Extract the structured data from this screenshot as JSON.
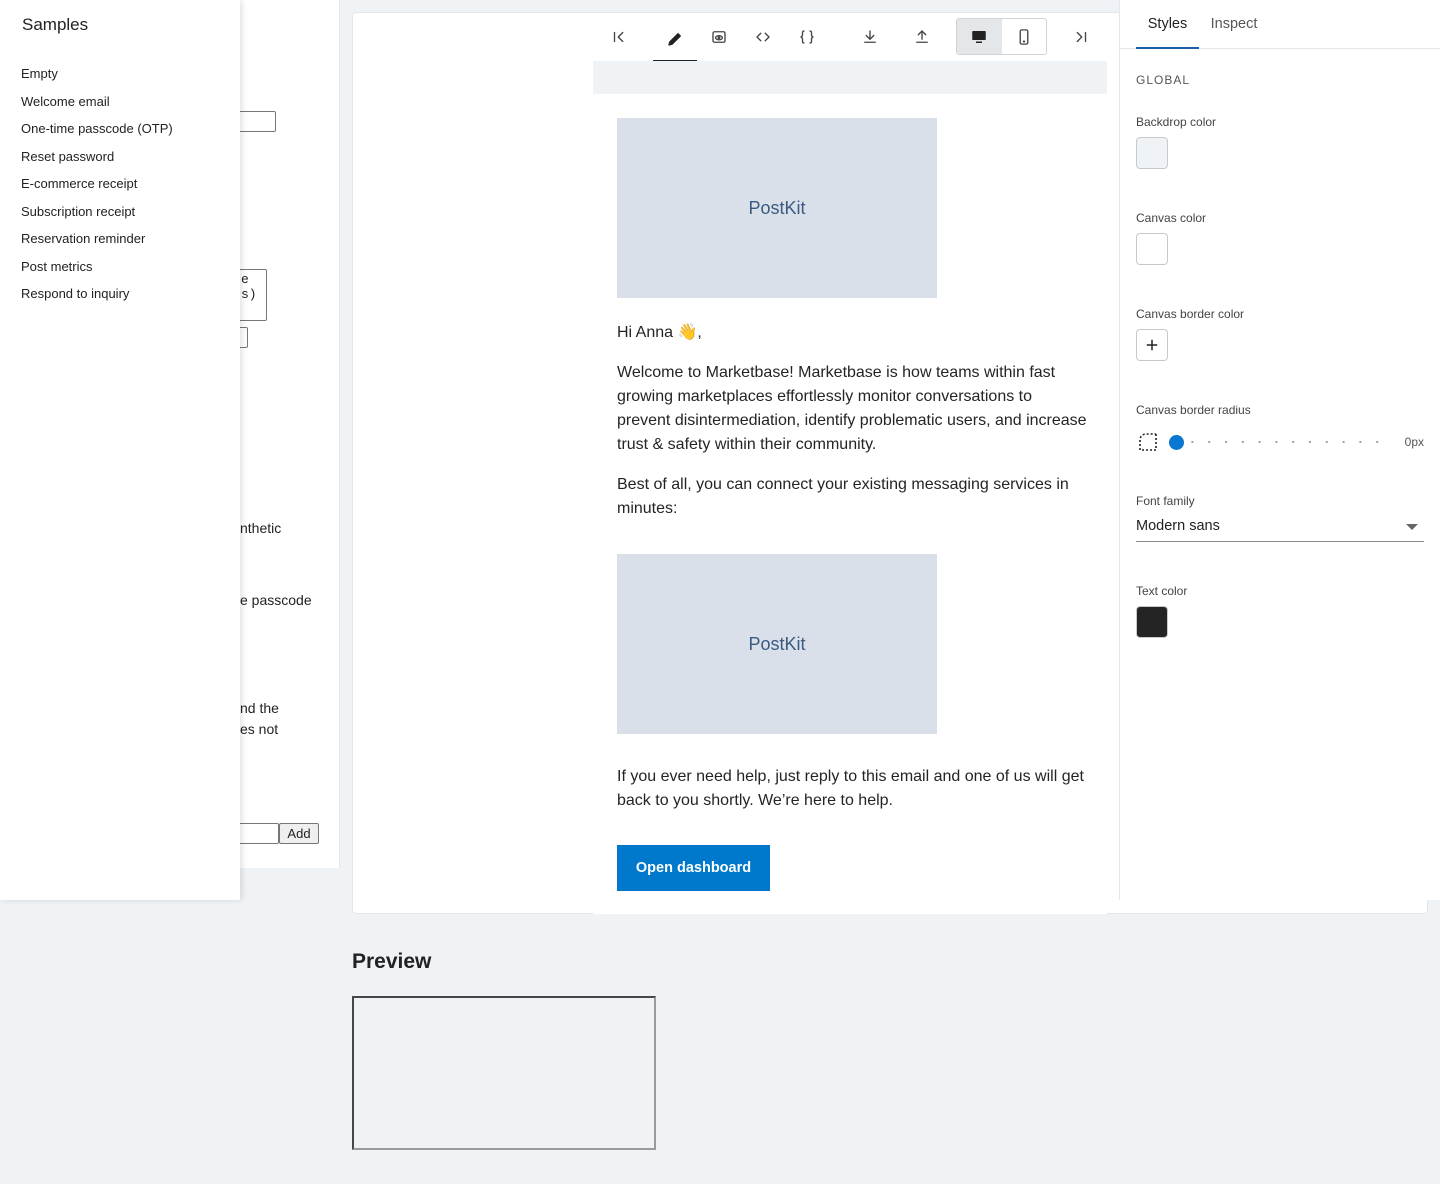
{
  "background_form": {
    "textarea_text": "e\ns)",
    "fragment_1": "nthetic",
    "fragment_2": "e passcode",
    "fragment_3": "nd the",
    "fragment_4": "es not",
    "add_label": "Add"
  },
  "samples": {
    "title": "Samples",
    "items": [
      {
        "label": "Empty"
      },
      {
        "label": "Welcome email"
      },
      {
        "label": "One-time passcode (OTP)"
      },
      {
        "label": "Reset password"
      },
      {
        "label": "E-commerce receipt"
      },
      {
        "label": "Subscription receipt"
      },
      {
        "label": "Reservation reminder"
      },
      {
        "label": "Post metrics"
      },
      {
        "label": "Respond to inquiry"
      }
    ]
  },
  "toolbar": {
    "buttons": [
      {
        "icon": "first-page-icon"
      },
      {
        "icon": "edit-icon",
        "active": true
      },
      {
        "icon": "preview-icon"
      },
      {
        "icon": "code-icon"
      },
      {
        "icon": "json-icon"
      },
      {
        "icon": "download-icon"
      },
      {
        "icon": "upload-icon"
      },
      {
        "icon": "desktop-icon",
        "active": true
      },
      {
        "icon": "mobile-icon"
      },
      {
        "icon": "last-page-icon"
      }
    ]
  },
  "email": {
    "image_1_alt": "PostKit",
    "greeting": "Hi Anna 👋,",
    "paragraph_1": "Welcome to Marketbase! Marketbase is how teams within fast growing marketplaces effortlessly monitor conversations to prevent disintermediation, identify problematic users, and increase trust & safety within their community.",
    "paragraph_2": "Best of all, you can connect your existing messaging services in minutes:",
    "image_2_alt": "PostKit",
    "paragraph_3": "If you ever need help, just reply to this email and one of us will get back to you shortly. We’re here to help.",
    "button_label": "Open dashboard",
    "button_color": "#0079cc"
  },
  "preview": {
    "title": "Preview"
  },
  "inspector": {
    "tabs": [
      {
        "label": "Styles",
        "active": true
      },
      {
        "label": "Inspect"
      }
    ],
    "section": "GLOBAL",
    "backdrop_color_label": "Backdrop color",
    "backdrop_color": "#f0f3f6",
    "canvas_color_label": "Canvas color",
    "canvas_color": "#ffffff",
    "canvas_border_color_label": "Canvas border color",
    "canvas_border_radius_label": "Canvas border radius",
    "canvas_border_radius_value": "0px",
    "font_family_label": "Font family",
    "font_family_value": "Modern sans",
    "text_color_label": "Text color",
    "text_color": "#242424"
  }
}
